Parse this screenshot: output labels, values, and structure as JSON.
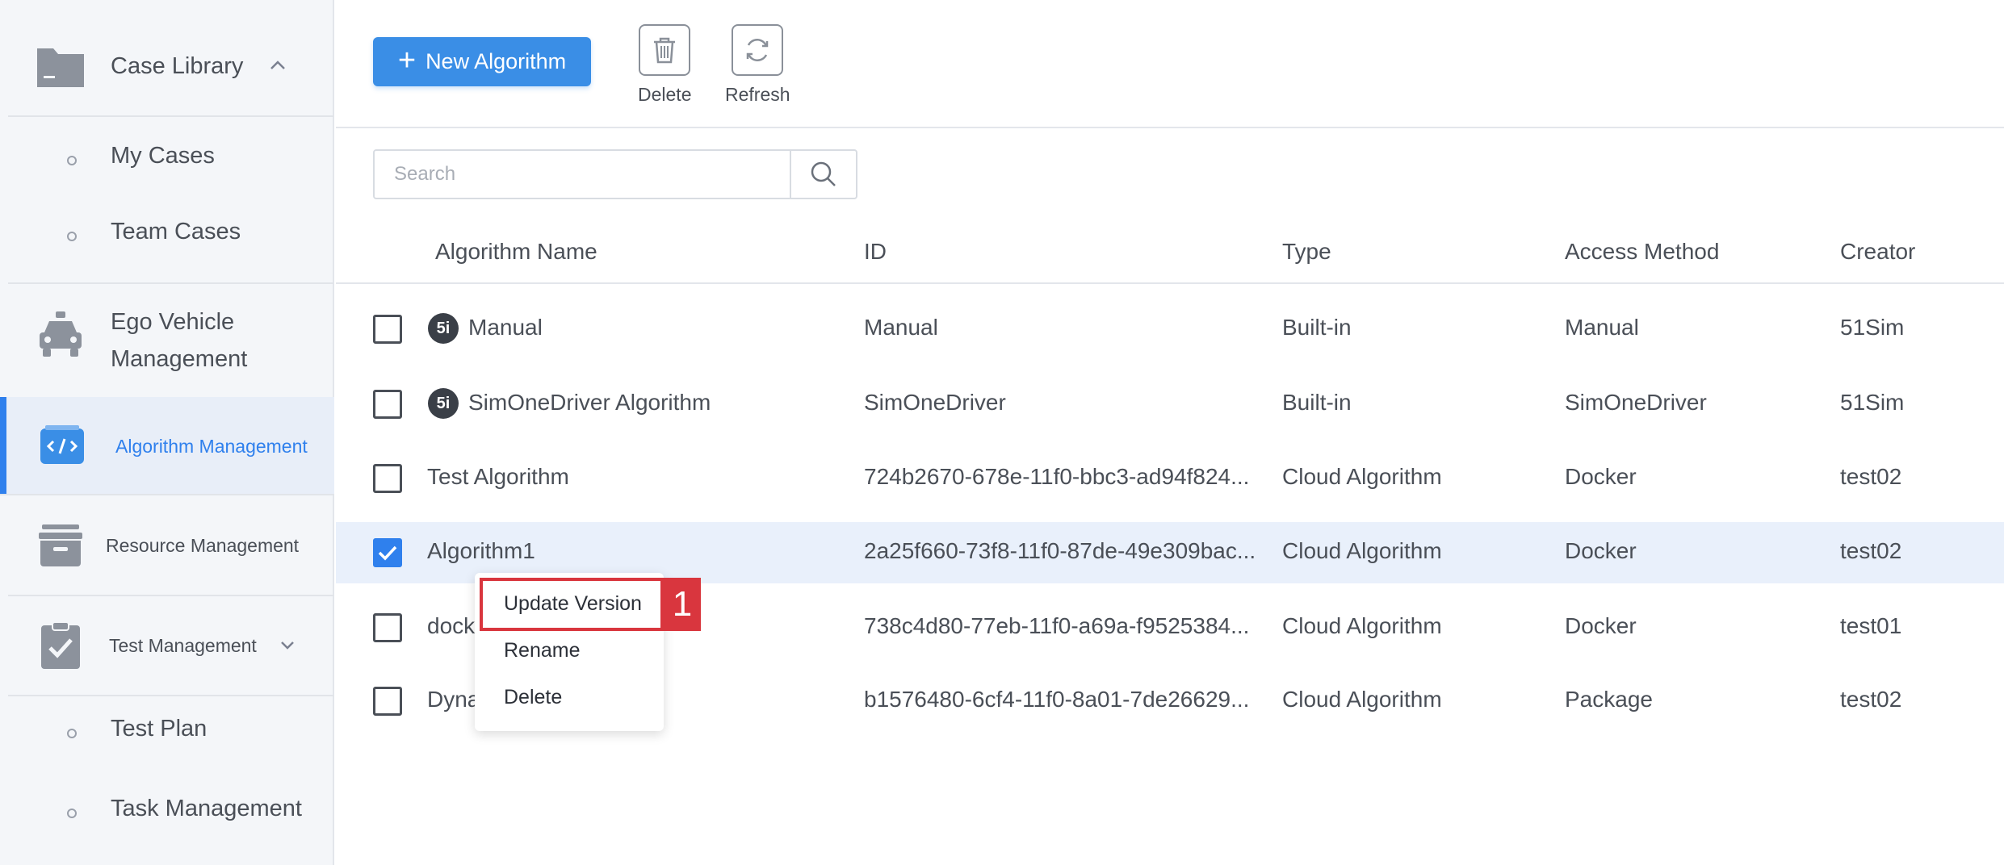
{
  "sidebar": {
    "case_library": "Case Library",
    "my_cases": "My Cases",
    "team_cases": "Team Cases",
    "ego_vehicle_line1": "Ego Vehicle",
    "ego_vehicle_line2": "Management",
    "algorithm_management": "Algorithm Management",
    "resource_management": "Resource Management",
    "test_management": "Test Management",
    "test_plan": "Test Plan",
    "task_management": "Task Management"
  },
  "toolbar": {
    "new_algorithm": "New Algorithm",
    "delete": "Delete",
    "refresh": "Refresh"
  },
  "search": {
    "placeholder": "Search"
  },
  "table": {
    "headers": [
      "Algorithm Name",
      "ID",
      "Type",
      "Access Method",
      "Creator"
    ],
    "rows": [
      {
        "name": "Manual",
        "id": "Manual",
        "type": "Built-in",
        "access": "Manual",
        "creator": "51Sim",
        "builtin_badge": "5i",
        "checked": false
      },
      {
        "name": "SimOneDriver Algorithm",
        "id": "SimOneDriver",
        "type": "Built-in",
        "access": "SimOneDriver",
        "creator": "51Sim",
        "builtin_badge": "5i",
        "checked": false
      },
      {
        "name": "Test Algorithm",
        "id": "724b2670-678e-11f0-bbc3-ad94f824...",
        "type": "Cloud Algorithm",
        "access": "Docker",
        "creator": "test02",
        "checked": false
      },
      {
        "name": "Algorithm1",
        "id": "2a25f660-73f8-11f0-87de-49e309bac...",
        "type": "Cloud Algorithm",
        "access": "Docker",
        "creator": "test02",
        "checked": true
      },
      {
        "name": "dock",
        "id": "738c4d80-77eb-11f0-a69a-f9525384...",
        "type": "Cloud Algorithm",
        "access": "Docker",
        "creator": "test01",
        "checked": false
      },
      {
        "name": "Dyna",
        "id": "b1576480-6cf4-11f0-8a01-7de26629...",
        "type": "Cloud Algorithm",
        "access": "Package",
        "creator": "test02",
        "checked": false
      }
    ]
  },
  "context_menu": {
    "items": [
      "Update Version",
      "Rename",
      "Delete"
    ],
    "highlight_number": "1"
  },
  "colors": {
    "accent": "#2f80ed",
    "button": "#3a8ee6",
    "highlight": "#d9363e",
    "selected_row": "#e9f0fb"
  }
}
